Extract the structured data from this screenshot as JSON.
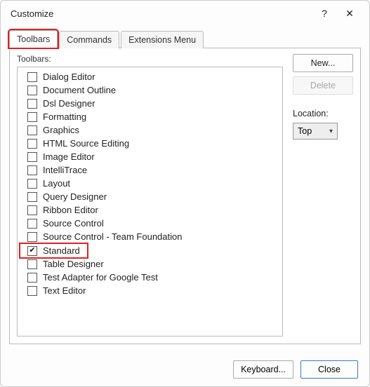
{
  "window": {
    "title": "Customize",
    "help_tooltip": "?",
    "close_tooltip": "Close"
  },
  "tabs": {
    "toolbars": "Toolbars",
    "commands": "Commands",
    "extensions": "Extensions Menu",
    "active": "toolbars"
  },
  "list": {
    "label": "Toolbars:",
    "items": [
      {
        "label": "Dialog Editor",
        "checked": false
      },
      {
        "label": "Document Outline",
        "checked": false
      },
      {
        "label": "Dsl Designer",
        "checked": false
      },
      {
        "label": "Formatting",
        "checked": false
      },
      {
        "label": "Graphics",
        "checked": false
      },
      {
        "label": "HTML Source Editing",
        "checked": false
      },
      {
        "label": "Image Editor",
        "checked": false
      },
      {
        "label": "IntelliTrace",
        "checked": false
      },
      {
        "label": "Layout",
        "checked": false
      },
      {
        "label": "Query Designer",
        "checked": false
      },
      {
        "label": "Ribbon Editor",
        "checked": false
      },
      {
        "label": "Source Control",
        "checked": false
      },
      {
        "label": "Source Control - Team Foundation",
        "checked": false
      },
      {
        "label": "Standard",
        "checked": true,
        "highlight": true
      },
      {
        "label": "Table Designer",
        "checked": false
      },
      {
        "label": "Test Adapter for Google Test",
        "checked": false
      },
      {
        "label": "Text Editor",
        "checked": false
      }
    ]
  },
  "buttons": {
    "new": "New...",
    "delete": "Delete",
    "keyboard": "Keyboard...",
    "close": "Close"
  },
  "location": {
    "label": "Location:",
    "value": "Top"
  }
}
